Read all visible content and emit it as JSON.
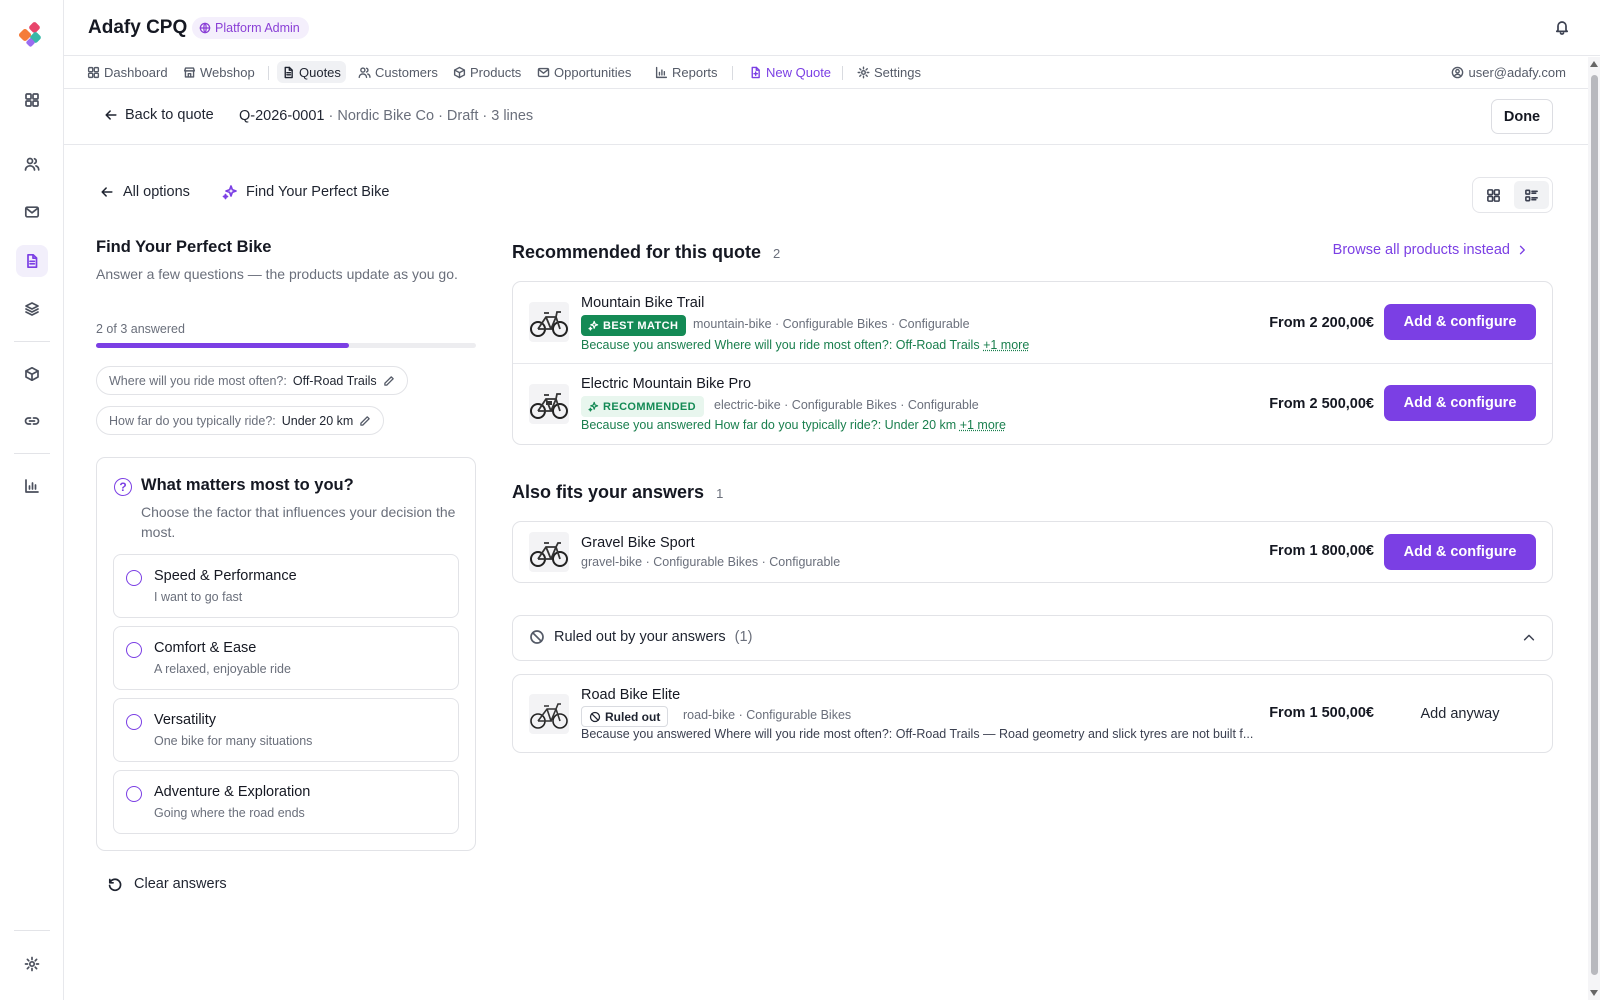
{
  "app": {
    "title": "Adafy CPQ",
    "role_badge": "Platform Admin"
  },
  "nav": {
    "items": [
      {
        "label": "Dashboard",
        "icon": "grid-icon"
      },
      {
        "label": "Webshop",
        "icon": "store-icon"
      },
      {
        "label": "Quotes",
        "icon": "document-icon"
      },
      {
        "label": "Customers",
        "icon": "users-icon"
      },
      {
        "label": "Products",
        "icon": "box-icon"
      },
      {
        "label": "Opportunities",
        "icon": "mail-icon"
      },
      {
        "label": "Reports",
        "icon": "chart-icon"
      },
      {
        "label": "New Quote",
        "icon": "file-plus-icon"
      },
      {
        "label": "Settings",
        "icon": "gear-icon"
      }
    ],
    "active": "Quotes",
    "user": "user@adafy.com"
  },
  "subheader": {
    "back_label": "Back to quote",
    "quote_id": "Q-2026-0001",
    "quote_meta": "· Nordic Bike Co · Draft · 3 lines",
    "done_label": "Done"
  },
  "wizard": {
    "all_options_label": "All options",
    "name": "Find Your Perfect Bike",
    "title": "Find Your Perfect Bike",
    "subtitle": "Answer a few questions — the products update as you go.",
    "progress_text": "2 of 3 answered",
    "progress_fraction": 0.667,
    "answers": [
      {
        "question": "Where will you ride most often?:",
        "value": "Off-Road Trails"
      },
      {
        "question": "How far do you typically ride?:",
        "value": "Under 20 km"
      }
    ],
    "question": {
      "title": "What matters most to you?",
      "subtitle": "Choose the factor that influences your decision the most.",
      "options": [
        {
          "title": "Speed & Performance",
          "sub": "I want to go fast"
        },
        {
          "title": "Comfort & Ease",
          "sub": "A relaxed, enjoyable ride"
        },
        {
          "title": "Versatility",
          "sub": "One bike for many situations"
        },
        {
          "title": "Adventure & Exploration",
          "sub": "Going where the road ends"
        }
      ]
    },
    "clear_label": "Clear answers"
  },
  "recommended": {
    "title": "Recommended for this quote",
    "count": "2",
    "browse_label": "Browse all products instead",
    "items": [
      {
        "name": "Mountain Bike Trail",
        "badge": "BEST MATCH",
        "meta": "mountain-bike · Configurable Bikes · Configurable",
        "reason_prefix": "Because you answered",
        "reason": "Where will you ride most often?: Off-Road Trails",
        "more": "+1 more",
        "price": "From 2 200,00€",
        "action": "Add & configure"
      },
      {
        "name": "Electric Mountain Bike Pro",
        "badge": "RECOMMENDED",
        "meta": "electric-bike · Configurable Bikes · Configurable",
        "reason_prefix": "Because you answered",
        "reason": "How far do you typically ride?: Under 20 km",
        "more": "+1 more",
        "price": "From 2 500,00€",
        "action": "Add & configure"
      }
    ]
  },
  "also_fits": {
    "title": "Also fits your answers",
    "count": "1",
    "items": [
      {
        "name": "Gravel Bike Sport",
        "meta": "gravel-bike · Configurable Bikes · Configurable",
        "price": "From 1 800,00€",
        "action": "Add & configure"
      }
    ]
  },
  "ruled_out": {
    "title": "Ruled out by your answers",
    "count": "(1)",
    "items": [
      {
        "name": "Road Bike Elite",
        "badge": "Ruled out",
        "meta": "road-bike · Configurable Bikes",
        "reason": "Because you answered Where will you ride most often?: Off-Road Trails — Road geometry and slick tyres are not built f...",
        "price": "From 1 500,00€",
        "action": "Add anyway"
      }
    ]
  },
  "colors": {
    "accent": "#7b3fe4",
    "match_green": "#148a55",
    "border": "#e2e3e7"
  }
}
